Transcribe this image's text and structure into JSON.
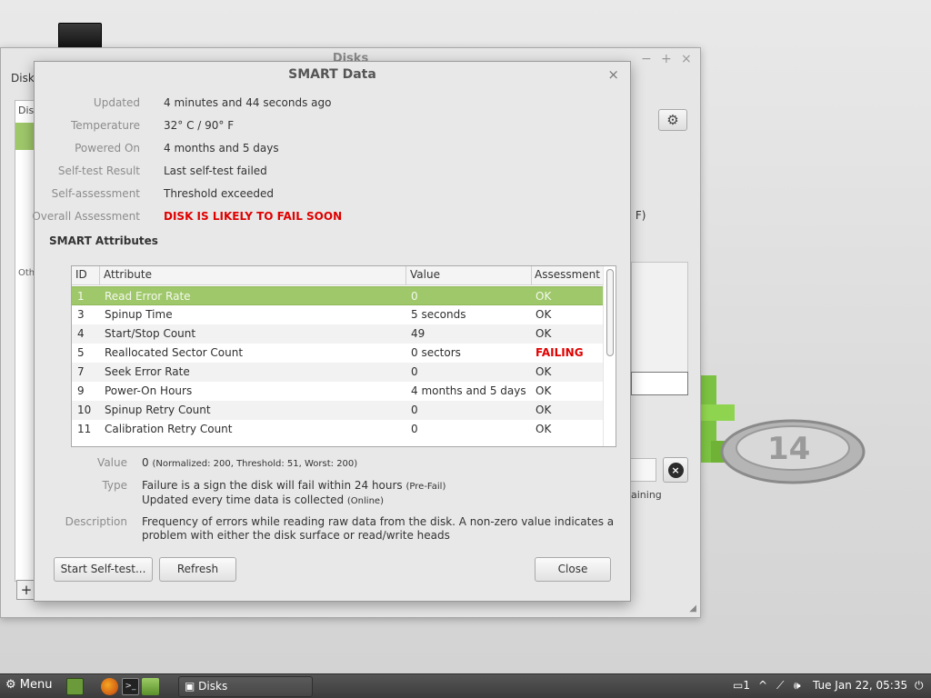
{
  "background_window": {
    "title": "Disks",
    "label": "Disk",
    "list_header": "Dis",
    "list_other": "Oth",
    "temp_fragment": "° F)",
    "remaining_fragment": "aining",
    "add_button": "+",
    "settings_icon": "gear-icon"
  },
  "dialog": {
    "title": "SMART Data",
    "close_glyph": "×",
    "info": [
      {
        "label": "Updated",
        "value": "4 minutes and 44 seconds ago"
      },
      {
        "label": "Temperature",
        "value": "32° C / 90° F"
      },
      {
        "label": "Powered On",
        "value": "4 months and 5 days"
      },
      {
        "label": "Self-test Result",
        "value": "Last self-test failed"
      },
      {
        "label": "Self-assessment",
        "value": "Threshold exceeded"
      },
      {
        "label": "Overall Assessment",
        "value": "DISK IS LIKELY TO FAIL SOON"
      }
    ],
    "attributes_heading": "SMART Attributes",
    "table": {
      "columns": [
        "ID",
        "Attribute",
        "Value",
        "Assessment"
      ],
      "rows": [
        {
          "id": "1",
          "attribute": "Read Error Rate",
          "value": "0",
          "assessment": "OK"
        },
        {
          "id": "3",
          "attribute": "Spinup Time",
          "value": "5 seconds",
          "assessment": "OK"
        },
        {
          "id": "4",
          "attribute": "Start/Stop Count",
          "value": "49",
          "assessment": "OK"
        },
        {
          "id": "5",
          "attribute": "Reallocated Sector Count",
          "value": "0 sectors",
          "assessment": "FAILING"
        },
        {
          "id": "7",
          "attribute": "Seek Error Rate",
          "value": "0",
          "assessment": "OK"
        },
        {
          "id": "9",
          "attribute": "Power-On Hours",
          "value": "4 months and 5 days",
          "assessment": "OK"
        },
        {
          "id": "10",
          "attribute": "Spinup Retry Count",
          "value": "0",
          "assessment": "OK"
        },
        {
          "id": "11",
          "attribute": "Calibration Retry Count",
          "value": "0",
          "assessment": "OK"
        }
      ],
      "selected_row": 0
    },
    "details": {
      "value_label": "Value",
      "value": "0",
      "value_note": "(Normalized: 200, Threshold: 51, Worst: 200)",
      "type_label": "Type",
      "type_line1": "Failure is a sign the disk will fail within 24 hours",
      "type_line1_note": "(Pre-Fail)",
      "type_line2": "Updated every time data is collected",
      "type_line2_note": "(Online)",
      "description_label": "Description",
      "description": "Frequency of errors while reading raw data from the disk. A non-zero value indicates a problem with either the disk surface or read/write heads"
    },
    "buttons": {
      "self_test": "Start Self-test...",
      "refresh": "Refresh",
      "close": "Close"
    }
  },
  "taskbar": {
    "menu_label": "Menu",
    "task_label": "Disks",
    "notification_count": "1",
    "clock": "Tue Jan 22, 05:35"
  },
  "colors": {
    "selection": "#9fc86a",
    "failing": "#e00000"
  }
}
